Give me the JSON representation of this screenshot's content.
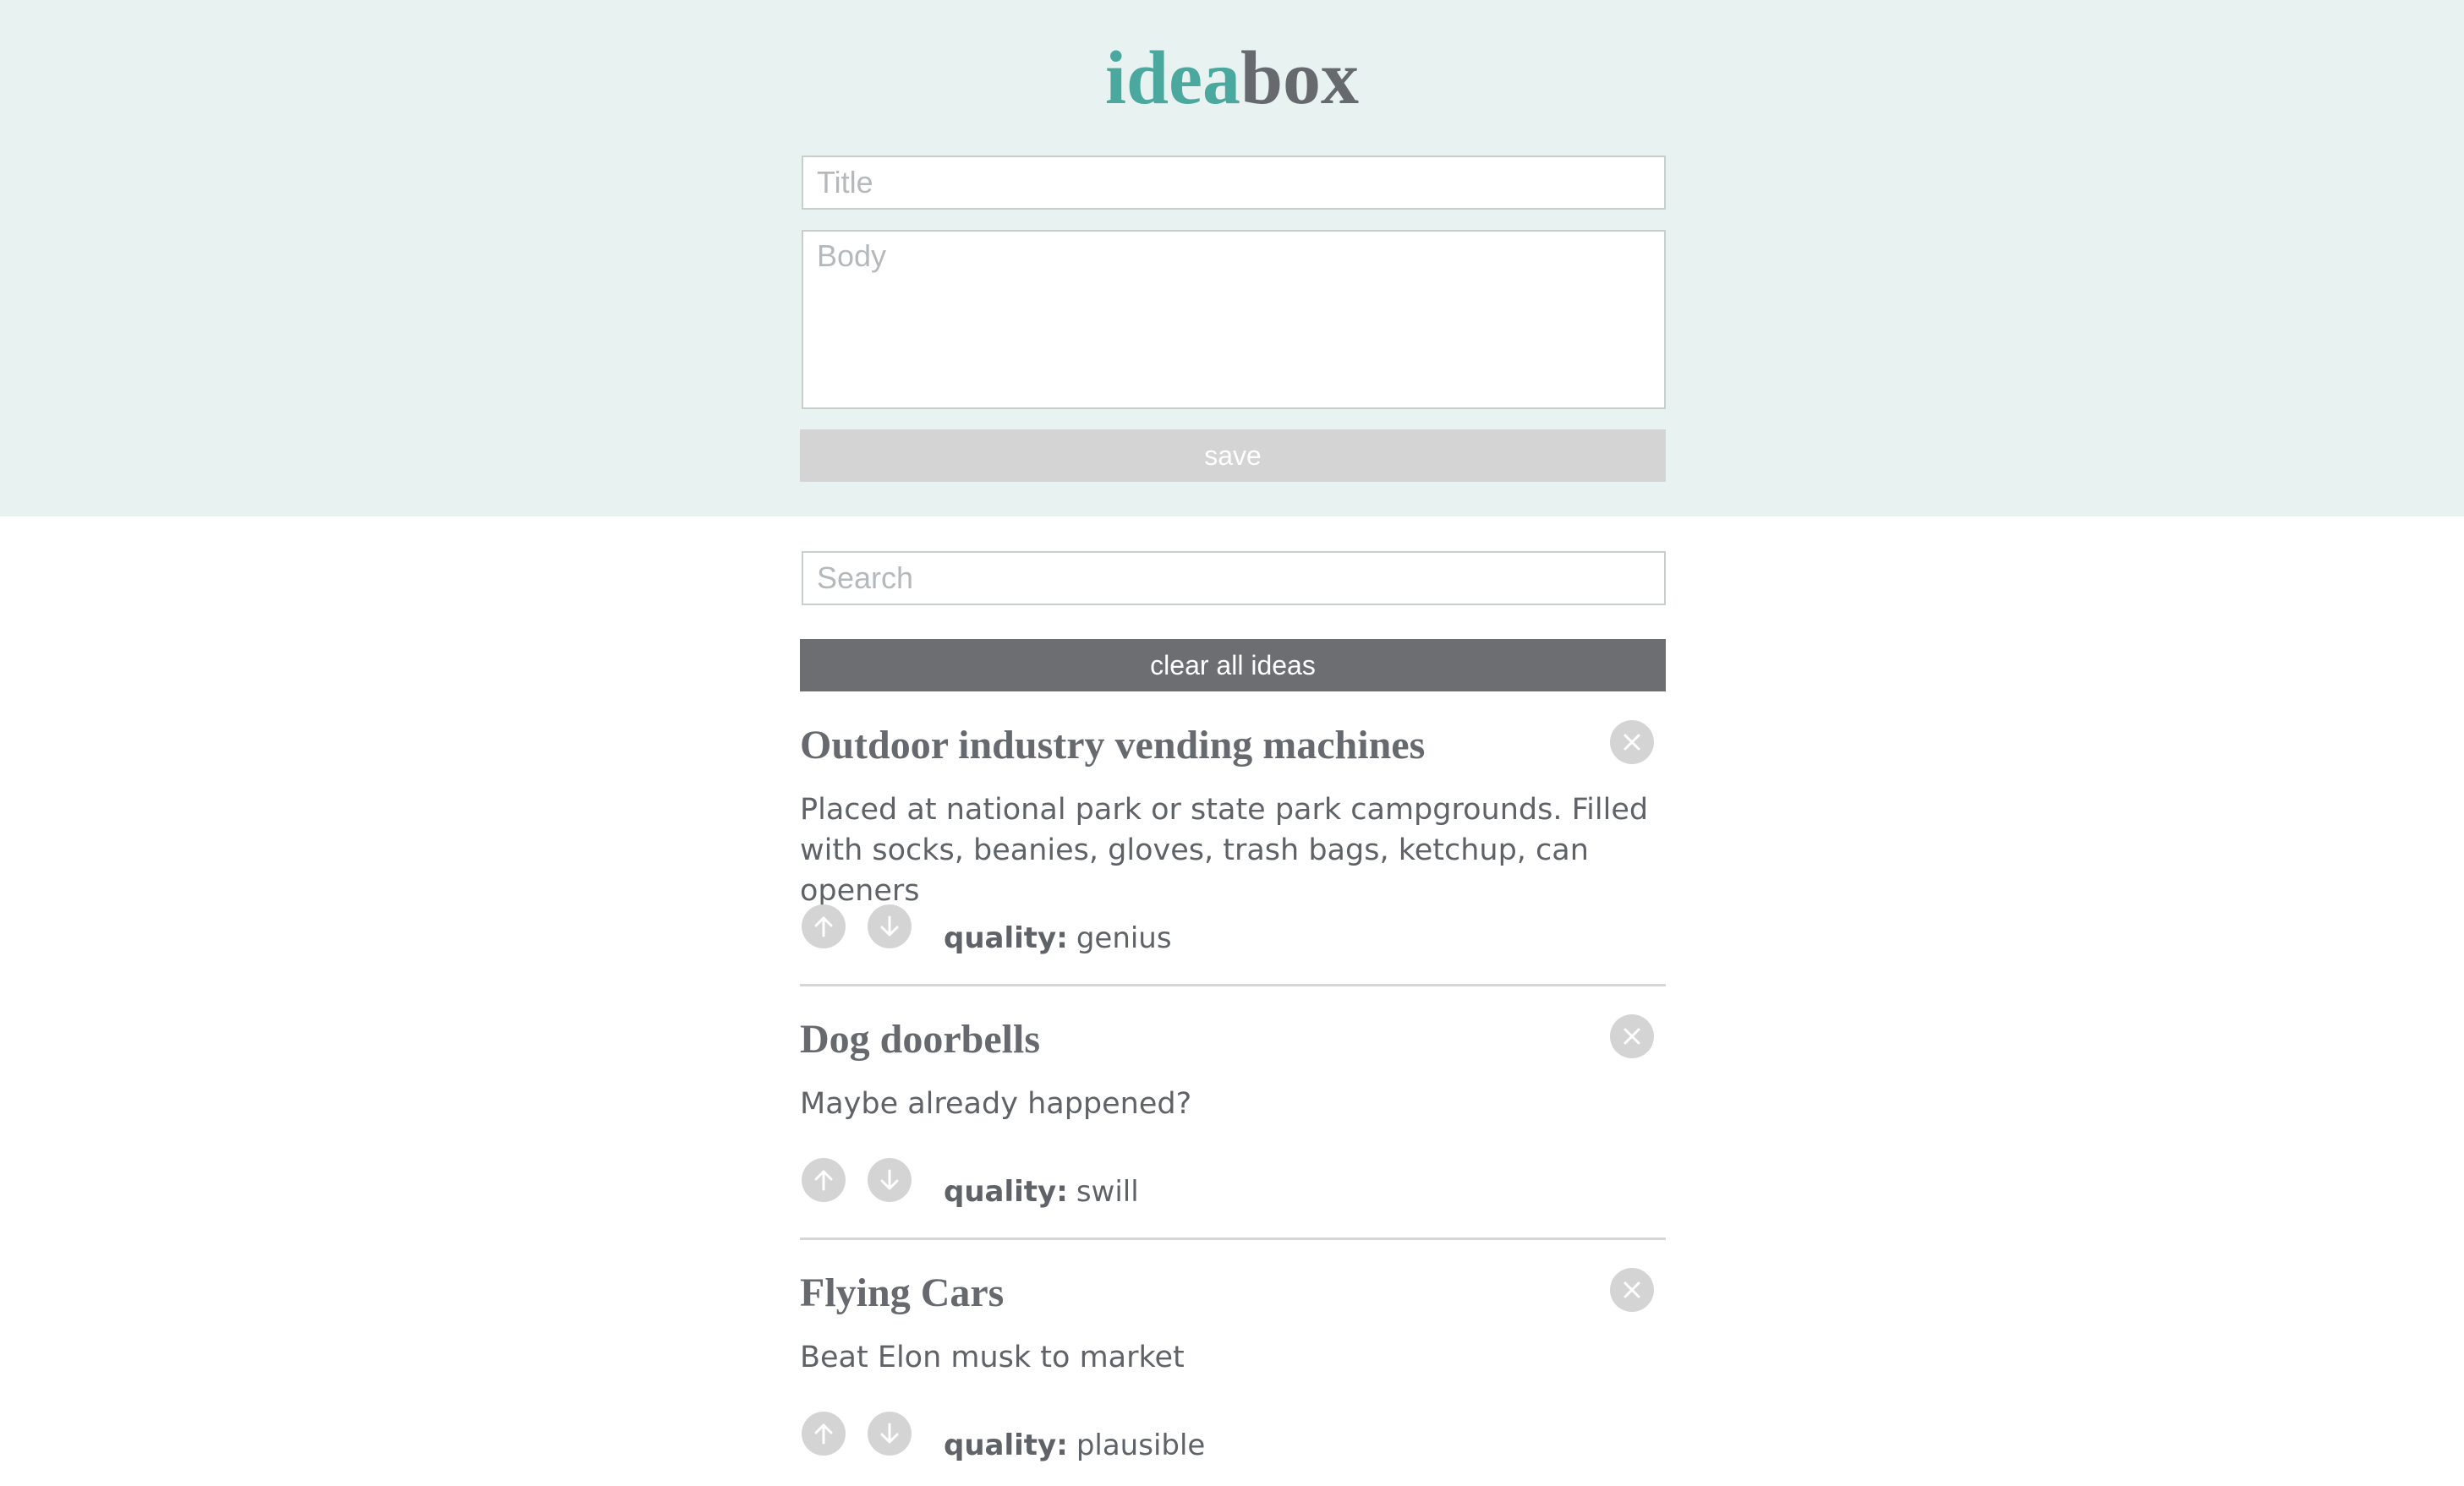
{
  "header": {
    "logo_part1": "idea",
    "logo_part2": "box",
    "title_placeholder": "Title",
    "body_placeholder": "Body",
    "save_label": "save"
  },
  "controls": {
    "search_placeholder": "Search",
    "clear_label": "clear all ideas"
  },
  "ideas": [
    {
      "title": "Outdoor industry vending machines",
      "body": "Placed at national park or state park campgrounds. Filled with socks, beanies, gloves, trash bags, ketchup, can openers",
      "quality_label": "quality:",
      "quality": "genius"
    },
    {
      "title": "Dog doorbells",
      "body": "Maybe already happened?",
      "quality_label": "quality:",
      "quality": "swill"
    },
    {
      "title": "Flying Cars",
      "body": "Beat Elon musk to market",
      "quality_label": "quality:",
      "quality": "plausible"
    }
  ],
  "colors": {
    "header_bg": "#e8f2f1",
    "brand_teal": "#4aa89e",
    "brand_gray": "#666a6f",
    "save_bg": "#d4d4d5",
    "clear_bg": "#6d6e71"
  },
  "icons": {
    "delete": "close-icon",
    "upvote": "arrow-up-icon",
    "downvote": "arrow-down-icon"
  }
}
